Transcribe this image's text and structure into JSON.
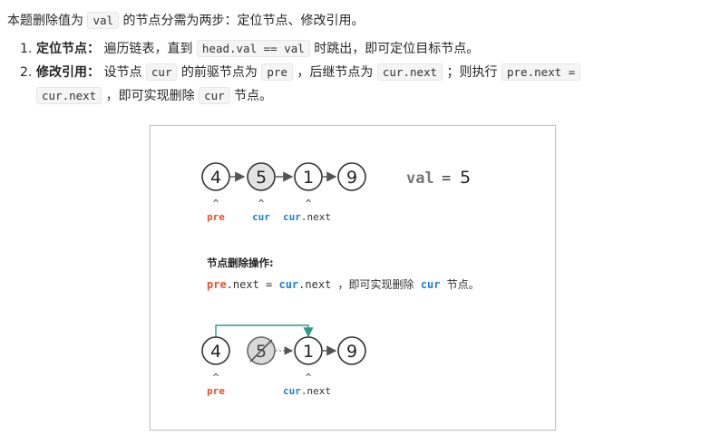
{
  "intro": {
    "text_before": "本题删除值为 ",
    "code": "val",
    "text_after": " 的节点分需为两步：定位节点、修改引用。"
  },
  "steps": [
    {
      "number": "1.",
      "title": "定位节点：",
      "text1": " 遍历链表，直到 ",
      "code1": "head.val == val",
      "text2": " 时跳出，即可定位目标节点。"
    },
    {
      "number": "2.",
      "title": "修改引用：",
      "text1": " 设节点 ",
      "code1": "cur",
      "text2": " 的前驱节点为 ",
      "code2": "pre",
      "text3": " ，后继节点为 ",
      "code3": "cur.next",
      "text4": " ；则执行 ",
      "code4": "pre.next =",
      "code5": "cur.next",
      "text5": " ，即可实现删除 ",
      "code6": "cur",
      "text6": " 节点。"
    }
  ],
  "figure": {
    "top_nodes": [
      "4",
      "5",
      "1",
      "9"
    ],
    "val_label": "val",
    "val_eq": "=",
    "val_value": "5",
    "caret": "^",
    "pre_label": "pre",
    "cur_label": "cur",
    "cur_next_prefix": "cur",
    "cur_next_suffix": ".next",
    "section_title": "节点删除操作:",
    "op_pre": "pre",
    "op_mid": ".next = ",
    "op_cur": "cur",
    "op_tail": ".next ，即可实现删除 ",
    "op_cur2": "cur",
    "op_end": " 节点。",
    "bottom_nodes": [
      "4",
      "5",
      "1",
      "9"
    ],
    "colors": {
      "pre": "#e8502f",
      "cur": "#1f7fd6",
      "node_stroke": "#333333",
      "node_fill_highlight": "#e3e3e3",
      "arrow": "#555555",
      "link_arrow": "#2e9a87",
      "val_gray": "#777777"
    }
  }
}
